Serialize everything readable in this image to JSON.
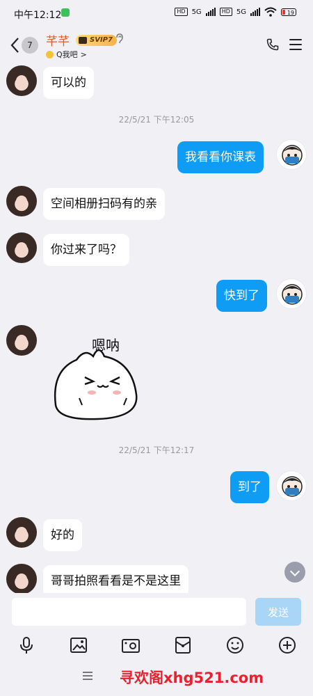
{
  "status_bar": {
    "time": "中午12:12",
    "net1": "5G",
    "net2": "5G",
    "hd": "HD",
    "battery": "19"
  },
  "header": {
    "back_label": "‹",
    "unread_count": "7",
    "contact_name": "芊芊",
    "vip_label": "SVIP7",
    "subtitle": "Q我吧",
    "subtitle_arrow": ">"
  },
  "messages": [
    {
      "text": "可以的"
    },
    {
      "timestamp": "22/5/21 下午12:05"
    },
    {
      "text": "我看看你课表"
    },
    {
      "text": "空间相册扫码有的亲"
    },
    {
      "text": "你过来了吗？"
    },
    {
      "text": "快到了"
    },
    {
      "sticker_text": "嗯呐"
    },
    {
      "timestamp": "22/5/21 下午12:17"
    },
    {
      "text": "到了"
    },
    {
      "text": "好的"
    },
    {
      "text": "哥哥拍照看看是不是这里"
    }
  ],
  "input": {
    "value": "",
    "send_label": "发送"
  },
  "watermark": "寻欢阁xhg521.com",
  "colors": {
    "outgoing_bubble": "#0f9cf5",
    "incoming_bubble": "#ffffff",
    "name_color": "#e15b22",
    "send_disabled": "#a9d6f7"
  },
  "icons": [
    "mic-icon",
    "image-icon",
    "camera-icon",
    "red-packet-icon",
    "emoji-icon",
    "plus-icon",
    "phone-icon",
    "menu-icon"
  ]
}
